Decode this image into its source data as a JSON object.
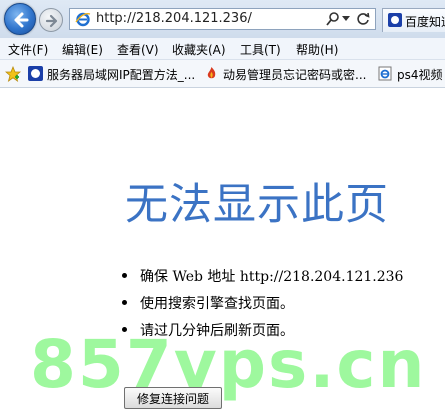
{
  "address_bar": {
    "url": "http://218.204.121.236/"
  },
  "tab": {
    "label": "百度知道"
  },
  "menu": {
    "items": [
      "文件(F)",
      "编辑(E)",
      "查看(V)",
      "收藏夹(A)",
      "工具(T)",
      "帮助(H)"
    ]
  },
  "favorites": {
    "items": [
      {
        "label": "服务器局域网IP配置方法_...",
        "icon": "baidu-paw-icon"
      },
      {
        "label": "动易管理员忘记密码或密...",
        "icon": "flame-icon"
      },
      {
        "label": "ps4视频",
        "icon": "ie-page-icon"
      }
    ]
  },
  "error_page": {
    "headline": "无法显示此页",
    "bullets": [
      "确保 Web 地址 http://218.204.121.236",
      "使用搜索引擎查找页面。",
      "请过几分钟后刷新页面。"
    ],
    "repair_button": "修复连接问题"
  },
  "watermark": {
    "text": "857vps.cn"
  },
  "colors": {
    "headline": "#3b73c4",
    "watermark": "#78f578",
    "back_button": "#2f74cc"
  }
}
